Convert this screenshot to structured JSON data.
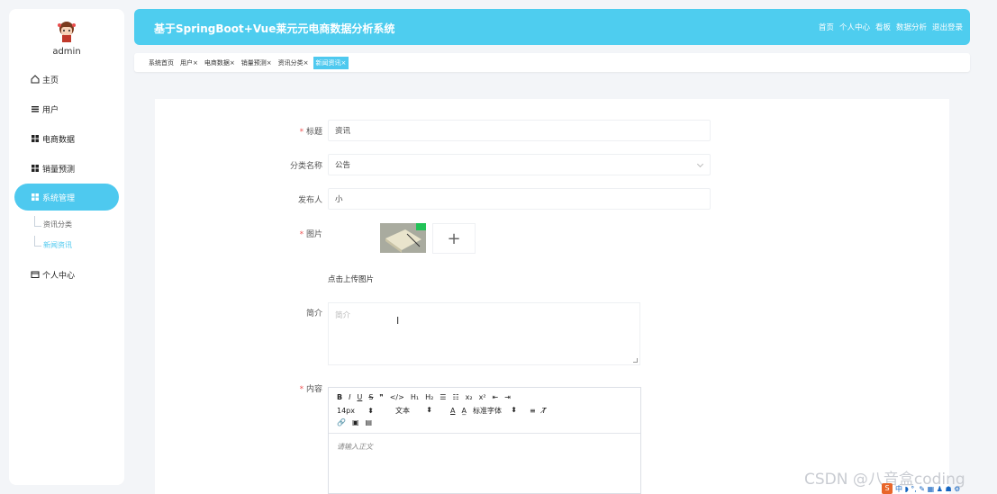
{
  "sidebar": {
    "user": "admin",
    "items": [
      {
        "label": "主页",
        "icon": "home-icon"
      },
      {
        "label": "用户",
        "icon": "list-icon"
      },
      {
        "label": "电商数据",
        "icon": "grid-icon"
      },
      {
        "label": "销量预测",
        "icon": "grid-icon"
      },
      {
        "label": "系统管理",
        "icon": "grid-icon"
      },
      {
        "label": "个人中心",
        "icon": "card-icon"
      }
    ],
    "sub_items": [
      "资讯分类",
      "新闻资讯"
    ]
  },
  "header": {
    "title": "基于SpringBoot+Vue莱元元电商数据分析系统",
    "nav": [
      "首页",
      "个人中心",
      "看板",
      "数据分析",
      "退出登录"
    ]
  },
  "tabs": [
    {
      "label": "系统首页",
      "close": ""
    },
    {
      "label": "用户",
      "close": "×"
    },
    {
      "label": "电商数据",
      "close": "×"
    },
    {
      "label": "销量预测",
      "close": "×"
    },
    {
      "label": "资讯分类",
      "close": "×"
    },
    {
      "label": "新闻资讯",
      "close": "×"
    }
  ],
  "form": {
    "title_label": "标题",
    "title_value": "资讯",
    "category_label": "分类名称",
    "category_value": "公告",
    "publisher_label": "发布人",
    "publisher_value": "小",
    "image_label": "图片",
    "upload_text": "点击上传图片",
    "upload_plus": "+",
    "summary_label": "简介",
    "summary_placeholder": "简介",
    "content_label": "内容",
    "required_mark": "*"
  },
  "editor": {
    "row1": [
      "B",
      "I",
      "U",
      "S",
      "❞",
      "</>",
      "H₁",
      "H₂",
      "☰",
      "☷",
      "x₂",
      "x²",
      "⇤",
      "⇥"
    ],
    "font_size": "14px",
    "font_type": "文本",
    "font_family": "标准字体",
    "row2_icons": [
      "A",
      "A̲"
    ],
    "row3": [
      "🔗",
      "▣",
      "▤"
    ],
    "placeholder": "请输入正文"
  },
  "watermark": "CSDN @八音盒coding",
  "ime": "中 ◗ °, ✎ ▦ ♟ ☗ ⚙"
}
